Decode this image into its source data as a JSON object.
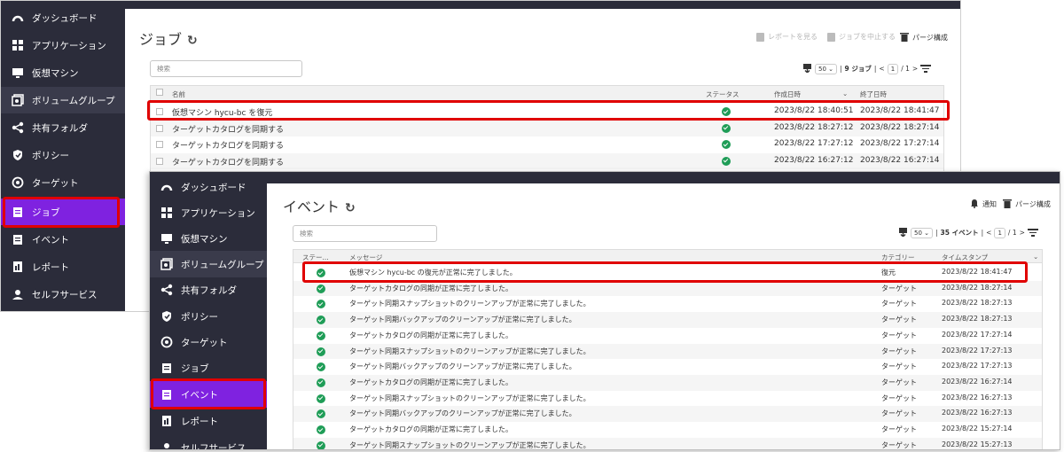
{
  "sidebar_items": {
    "dashboard": "ダッシュボード",
    "apps": "アプリケーション",
    "vm": "仮想マシン",
    "volume": "ボリュームグループ",
    "share": "共有フォルダ",
    "policy": "ポリシー",
    "target": "ターゲット",
    "jobs": "ジョブ",
    "events": "イベント",
    "reports": "レポート",
    "selfservice": "セルフサービス"
  },
  "jobs_page": {
    "title": "ジョブ",
    "toolbar": {
      "view_report": "レポートを見る",
      "stop_job": "ジョブを中止する",
      "purge": "パージ構成"
    },
    "search_placeholder": "検索",
    "pager": {
      "page_size": "50",
      "count": "9 ジョブ",
      "page": "1",
      "total": "/ 1"
    },
    "headers": {
      "name": "名前",
      "status": "ステータス",
      "created": "作成日時",
      "ended": "終了日時"
    },
    "rows": [
      {
        "name": "仮想マシン hycu-bc を復元",
        "created": "2023/8/22 18:40:51",
        "ended": "2023/8/22 18:41:47"
      },
      {
        "name": "ターゲットカタログを同期する",
        "created": "2023/8/22 18:27:12",
        "ended": "2023/8/22 18:27:14"
      },
      {
        "name": "ターゲットカタログを同期する",
        "created": "2023/8/22 17:27:12",
        "ended": "2023/8/22 17:27:14"
      },
      {
        "name": "ターゲットカタログを同期する",
        "created": "2023/8/22 16:27:12",
        "ended": "2023/8/22 16:27:14"
      }
    ]
  },
  "events_page": {
    "title": "イベント",
    "toolbar": {
      "notify": "通知",
      "purge": "パージ構成"
    },
    "search_placeholder": "検索",
    "pager": {
      "page_size": "50",
      "count": "35 イベント",
      "page": "1",
      "total": "/ 1"
    },
    "headers": {
      "status": "ステー...",
      "message": "メッセージ",
      "category": "カテゴリー",
      "timestamp": "タイムスタンプ"
    },
    "rows": [
      {
        "message": "仮想マシン hycu-bc の復元が正常に完了しました。",
        "category": "復元",
        "timestamp": "2023/8/22 18:41:47"
      },
      {
        "message": "ターゲットカタログの同期が正常に完了しました。",
        "category": "ターゲット",
        "timestamp": "2023/8/22 18:27:14"
      },
      {
        "message": "ターゲット同期スナップショットのクリーンアップが正常に完了しました。",
        "category": "ターゲット",
        "timestamp": "2023/8/22 18:27:13"
      },
      {
        "message": "ターゲット同期バックアップのクリーンアップが正常に完了しました。",
        "category": "ターゲット",
        "timestamp": "2023/8/22 18:27:13"
      },
      {
        "message": "ターゲットカタログの同期が正常に完了しました。",
        "category": "ターゲット",
        "timestamp": "2023/8/22 17:27:14"
      },
      {
        "message": "ターゲット同期スナップショットのクリーンアップが正常に完了しました。",
        "category": "ターゲット",
        "timestamp": "2023/8/22 17:27:13"
      },
      {
        "message": "ターゲット同期バックアップのクリーンアップが正常に完了しました。",
        "category": "ターゲット",
        "timestamp": "2023/8/22 17:27:13"
      },
      {
        "message": "ターゲットカタログの同期が正常に完了しました。",
        "category": "ターゲット",
        "timestamp": "2023/8/22 16:27:14"
      },
      {
        "message": "ターゲット同期スナップショットのクリーンアップが正常に完了しました。",
        "category": "ターゲット",
        "timestamp": "2023/8/22 16:27:13"
      },
      {
        "message": "ターゲット同期バックアップのクリーンアップが正常に完了しました。",
        "category": "ターゲット",
        "timestamp": "2023/8/22 16:27:13"
      },
      {
        "message": "ターゲットカタログの同期が正常に完了しました。",
        "category": "ターゲット",
        "timestamp": "2023/8/22 15:27:14"
      },
      {
        "message": "ターゲット同期スナップショットのクリーンアップが正常に完了しました。",
        "category": "ターゲット",
        "timestamp": "2023/8/22 15:27:13"
      }
    ]
  },
  "icons": [
    "dashboard-icon",
    "apps-icon",
    "monitor-icon",
    "volume-icon",
    "share-icon",
    "shield-icon",
    "target-icon",
    "clipboard-icon",
    "report-icon",
    "selfservice-icon",
    "refresh-icon",
    "trash-icon",
    "bell-icon",
    "filter-icon",
    "checkmark-icon"
  ],
  "colors": {
    "sidebar_bg": "#2b2c3a",
    "active_bg": "#7f22e0",
    "highlight_red": "#e00000",
    "status_ok": "#1f9d57"
  }
}
